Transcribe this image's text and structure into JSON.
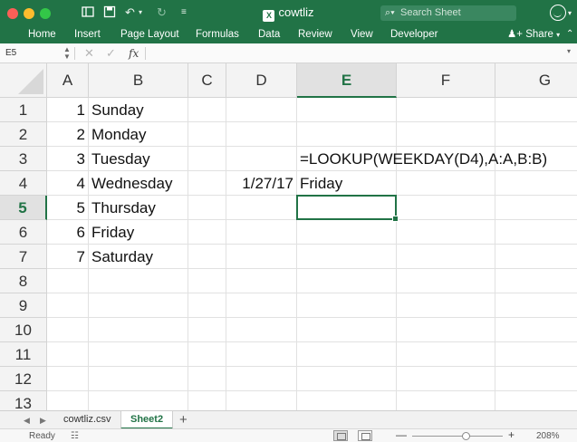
{
  "window": {
    "title": "cowtliz",
    "search_placeholder": "Search Sheet"
  },
  "ribbon": {
    "tabs": [
      "Home",
      "Insert",
      "Page Layout",
      "Formulas",
      "Data",
      "Review",
      "View",
      "Developer"
    ],
    "share_label": "Share"
  },
  "formula_bar": {
    "name_box": "E5",
    "fx_label": "fx",
    "content": ""
  },
  "grid": {
    "columns": [
      "A",
      "B",
      "C",
      "D",
      "E",
      "F",
      "G"
    ],
    "rows": [
      "1",
      "2",
      "3",
      "4",
      "5",
      "6",
      "7",
      "8",
      "9",
      "10",
      "11",
      "12",
      "13"
    ],
    "selected_column": "E",
    "selected_row": "5",
    "col_a": [
      "1",
      "2",
      "3",
      "4",
      "5",
      "6",
      "7"
    ],
    "col_b": [
      "Sunday",
      "Monday",
      "Tuesday",
      "Wednesday",
      "Thursday",
      "Friday",
      "Saturday"
    ],
    "e3": "=LOOKUP(WEEKDAY(D4),A:A,B:B)",
    "d4": "1/27/17",
    "e4": "Friday"
  },
  "sheets": {
    "tabs": [
      "cowtliz.csv",
      "Sheet2"
    ],
    "active": "Sheet2",
    "add_label": "+"
  },
  "status": {
    "text": "Ready",
    "zoom": "208%",
    "zoom_fraction": 0.6
  },
  "colors": {
    "accent": "#217346"
  }
}
